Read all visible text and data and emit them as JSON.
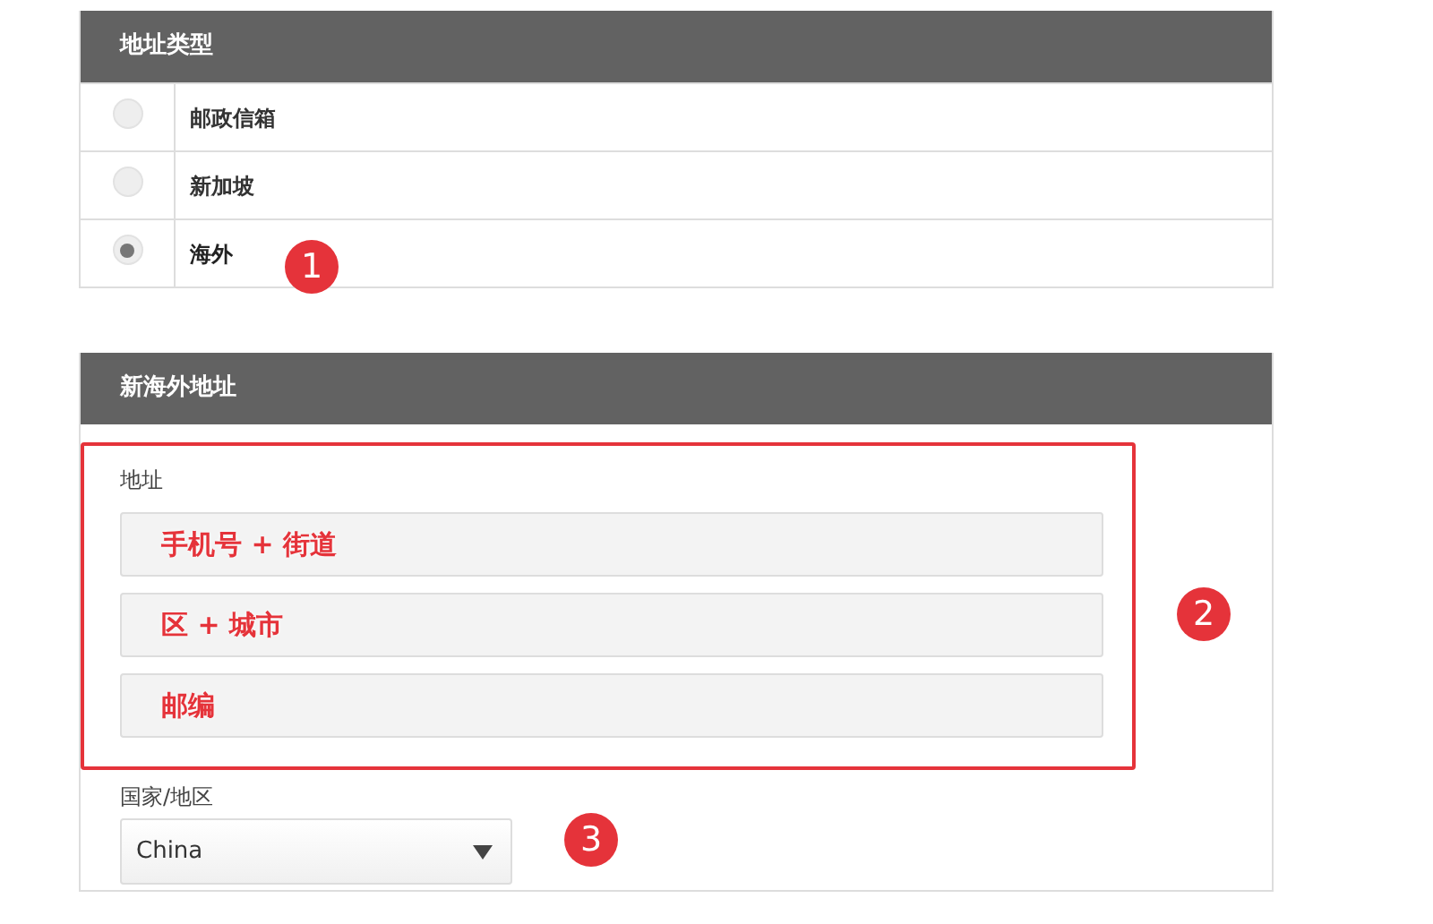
{
  "address_type": {
    "title": "地址类型",
    "options": [
      {
        "label": "邮政信箱",
        "selected": false
      },
      {
        "label": "新加坡",
        "selected": false
      },
      {
        "label": "海外",
        "selected": true
      }
    ]
  },
  "new_address": {
    "title": "新海外地址",
    "address_label": "地址",
    "fields": [
      {
        "annotation": "手机号 + 街道"
      },
      {
        "annotation": "区 + 城市"
      },
      {
        "annotation": "邮编"
      }
    ],
    "country_label": "国家/地区",
    "country_value": "China"
  },
  "callouts": [
    "1",
    "2",
    "3"
  ]
}
